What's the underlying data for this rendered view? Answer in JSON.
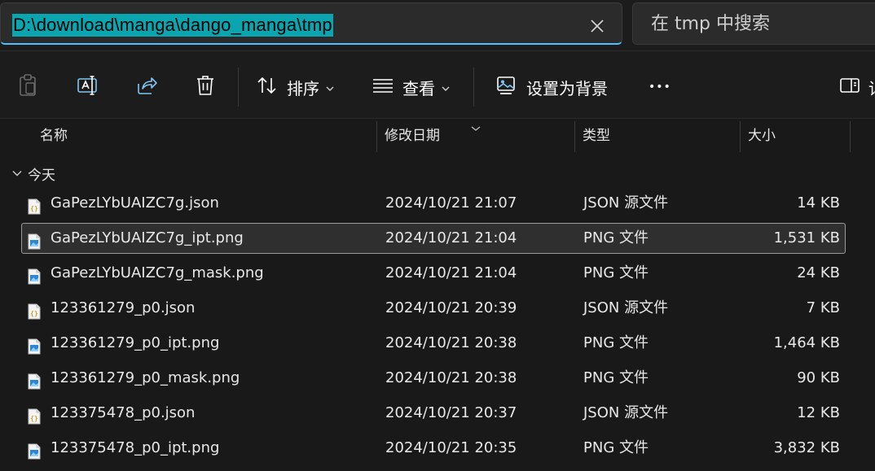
{
  "address": {
    "path": "D:\\download\\manga\\dango_manga\\tmp",
    "search_placeholder": "在 tmp 中搜索"
  },
  "toolbar": {
    "sort_label": "排序",
    "view_label": "查看",
    "set_background_label": "设置为背景",
    "more_label": "•••",
    "details_label": "详"
  },
  "columns": {
    "name": "名称",
    "date": "修改日期",
    "type": "类型",
    "size": "大小"
  },
  "group": {
    "label": "今天"
  },
  "files": [
    {
      "name": "GaPezLYbUAIZC7g.json",
      "date": "2024/10/21 21:07",
      "type": "JSON 源文件",
      "size": "14 KB",
      "kind": "json"
    },
    {
      "name": "GaPezLYbUAIZC7g_ipt.png",
      "date": "2024/10/21 21:04",
      "type": "PNG 文件",
      "size": "1,531 KB",
      "kind": "png",
      "selected": true
    },
    {
      "name": "GaPezLYbUAIZC7g_mask.png",
      "date": "2024/10/21 21:04",
      "type": "PNG 文件",
      "size": "24 KB",
      "kind": "png"
    },
    {
      "name": "123361279_p0.json",
      "date": "2024/10/21 20:39",
      "type": "JSON 源文件",
      "size": "7 KB",
      "kind": "json"
    },
    {
      "name": "123361279_p0_ipt.png",
      "date": "2024/10/21 20:38",
      "type": "PNG 文件",
      "size": "1,464 KB",
      "kind": "png"
    },
    {
      "name": "123361279_p0_mask.png",
      "date": "2024/10/21 20:38",
      "type": "PNG 文件",
      "size": "90 KB",
      "kind": "png"
    },
    {
      "name": "123375478_p0.json",
      "date": "2024/10/21 20:37",
      "type": "JSON 源文件",
      "size": "12 KB",
      "kind": "json"
    },
    {
      "name": "123375478_p0_ipt.png",
      "date": "2024/10/21 20:35",
      "type": "PNG 文件",
      "size": "3,832 KB",
      "kind": "png"
    }
  ],
  "colors": {
    "accent": "#4cc2ff",
    "selection_highlight": "#0ba5b0",
    "background": "#191919"
  }
}
